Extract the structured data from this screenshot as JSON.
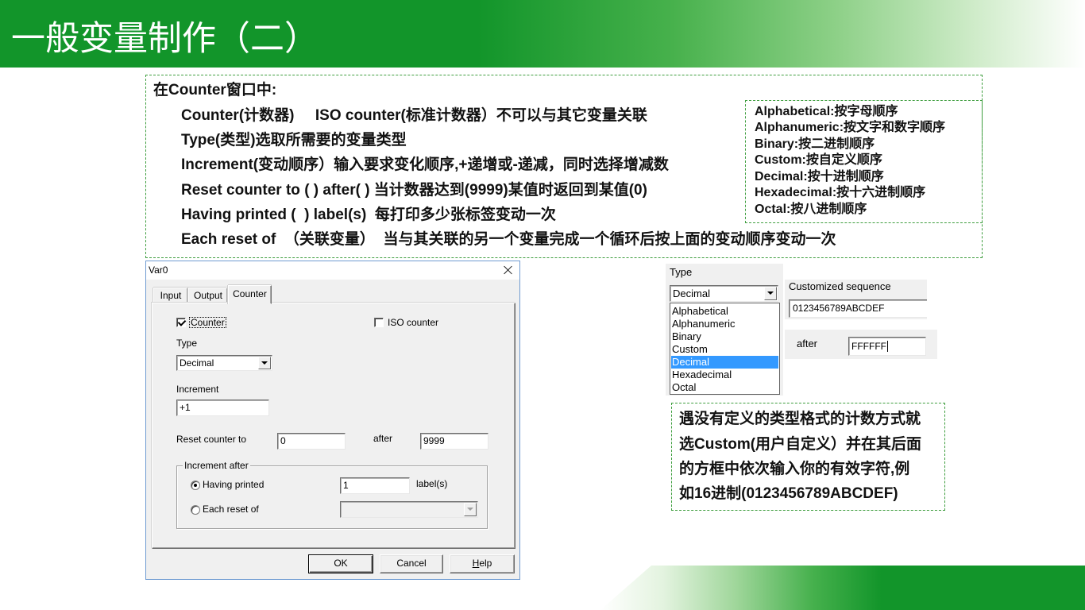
{
  "slide": {
    "title": "一般变量制作（二）"
  },
  "notes": {
    "heading": "在Counter窗口中:",
    "lines": [
      "Counter(计数器)     ISO counter(标准计数器）不可以与其它变量关联",
      "Type(类型)选取所需要的变量类型",
      "Increment(变动顺序）输入要求变化顺序,+递增或-递减，同时选择增减数",
      "Reset counter to ( ) after( ) 当计数器达到(9999)某值时返回到某值(0)",
      "Having printed (  ) label(s)  每打印多少张标签变动一次",
      "Each reset of  （关联变量）  当与其关联的另一个变量完成一个循环后按上面的变动顺序变动一次"
    ]
  },
  "type_legend": [
    "Alphabetical:按字母顺序",
    "Alphanumeric:按文字和数字顺序",
    "Binary:按二进制顺序",
    "Custom:按自定义顺序",
    "Decimal:按十进制顺序",
    "Hexadecimal:按十六进制顺序",
    "Octal:按八进制顺序"
  ],
  "dialog": {
    "title": "Var0",
    "tabs": [
      {
        "label": "Input",
        "active": false
      },
      {
        "label": "Output",
        "active": false
      },
      {
        "label": "Counter",
        "active": true
      }
    ],
    "counter_checkbox": {
      "label": "Counter",
      "checked": true
    },
    "iso_checkbox": {
      "label": "ISO counter",
      "checked": false
    },
    "type_label": "Type",
    "type_value": "Decimal",
    "increment_label": "Increment",
    "increment_value": "+1",
    "reset_label": "Reset counter to",
    "reset_value": "0",
    "after_label": "after",
    "after_value": "9999",
    "group_label": "Increment after",
    "having_printed": {
      "label": "Having printed",
      "checked": true,
      "value": "1",
      "suffix": "label(s)"
    },
    "each_reset": {
      "label": "Each reset of",
      "checked": false
    },
    "buttons": {
      "ok": "OK",
      "cancel": "Cancel",
      "help": "Help"
    }
  },
  "type_dropdown": {
    "label": "Type",
    "selected": "Decimal",
    "options": [
      "Alphabetical",
      "Alphanumeric",
      "Binary",
      "Custom",
      "Decimal",
      "Hexadecimal",
      "Octal"
    ],
    "highlighted_index": 4
  },
  "custom_sequence": {
    "label": "Customized sequence",
    "value": "0123456789ABCDEF"
  },
  "custom_after": {
    "label": "after",
    "value": "FFFFFF"
  },
  "custom_note": [
    "遇没有定义的类型格式的计数方式就",
    "选Custom(用户自定义）并在其后面",
    "的方框中依次输入你的有效字符,例",
    "如16进制(0123456789ABCDEF)"
  ],
  "colors": {
    "brand_green": "#12952a",
    "dashed_border": "#3f9e3f",
    "selection_blue": "#3399ff",
    "window_border": "#6f9bd1"
  }
}
